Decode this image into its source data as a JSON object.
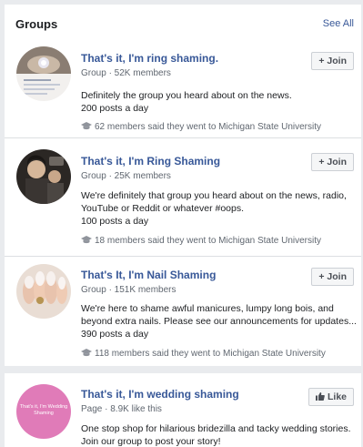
{
  "header": {
    "title": "Groups",
    "see_all": "See All"
  },
  "groups": [
    {
      "title": "That's it, I'm ring shaming.",
      "meta": "Group · 52K members",
      "description": "Definitely the group you heard about on the news.",
      "posts": "200 posts a day",
      "mutual": "62 members said they went to Michigan State University",
      "button": "+ Join"
    },
    {
      "title": "That's it, I'm Ring Shaming",
      "meta": "Group · 25K members",
      "description": "We're definitely that group you heard about on the news, radio, YouTube or Reddit or whatever #oops.",
      "posts": "100 posts a day",
      "mutual": "18 members said they went to Michigan State University",
      "button": "+ Join"
    },
    {
      "title": "That's It, I'm Nail Shaming",
      "meta": "Group · 151K members",
      "description": "We're here to shame awful manicures, lumpy long bois, and beyond extra nails. Please see our announcements for updates...",
      "posts": "390 posts a day",
      "mutual": "118 members said they went to Michigan State University",
      "button": "+ Join"
    },
    {
      "title": "That's it, I'm wedding shaming",
      "meta": "Page · 8.9K like this",
      "description": "One stop shop for hilarious bridezilla and tacky wedding stories. Join our group to post your story!",
      "button": "Like",
      "avatar_text": "That's it, I'm Wedding Shaming"
    }
  ],
  "colors": {
    "link": "#385898",
    "meta": "#606770",
    "page_avatar": "#e07bb8",
    "background": "#e9ebee"
  },
  "icons": {
    "mutual": "graduation-cap-icon",
    "like": "thumbs-up-icon"
  }
}
